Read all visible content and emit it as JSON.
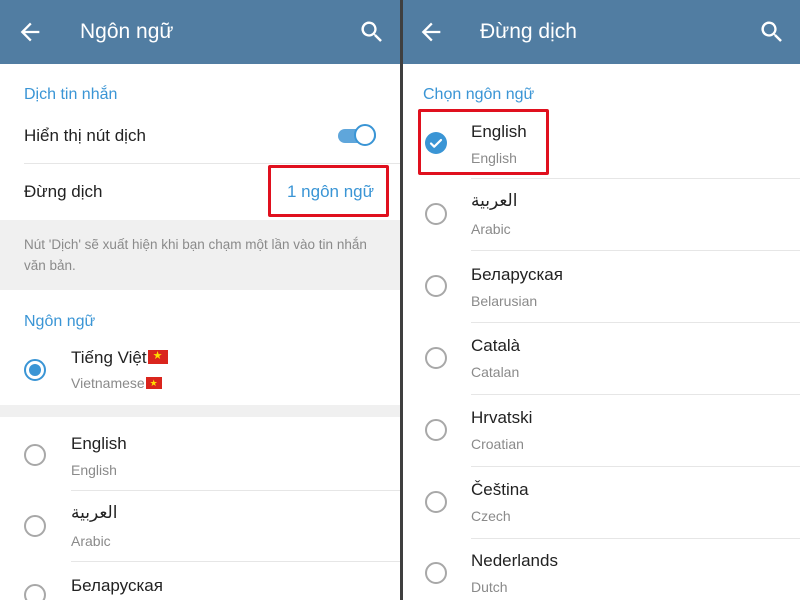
{
  "left": {
    "title": "Ngôn ngữ",
    "section_translate": "Dịch tin nhắn",
    "show_translate_button": {
      "label": "Hiển thị nút dịch",
      "enabled": true
    },
    "do_not_translate": {
      "label": "Đừng dịch",
      "value": "1 ngôn ngữ"
    },
    "hint": "Nút 'Dịch' sẽ xuất hiện khi bạn chạm một lần vào tin nhắn văn bản.",
    "section_language": "Ngôn ngữ",
    "current_language": {
      "name": "Tiếng Việt",
      "native": "Vietnamese",
      "selected": true
    },
    "languages": [
      {
        "name": "English",
        "native": "English"
      },
      {
        "name": "العربية",
        "native": "Arabic"
      },
      {
        "name": "Беларуская",
        "native": ""
      }
    ]
  },
  "right": {
    "title": "Đừng dịch",
    "section": "Chọn ngôn ngữ",
    "languages": [
      {
        "name": "English",
        "native": "English",
        "checked": true
      },
      {
        "name": "العربية",
        "native": "Arabic",
        "checked": false
      },
      {
        "name": "Беларуская",
        "native": "Belarusian",
        "checked": false
      },
      {
        "name": "Català",
        "native": "Catalan",
        "checked": false
      },
      {
        "name": "Hrvatski",
        "native": "Croatian",
        "checked": false
      },
      {
        "name": "Čeština",
        "native": "Czech",
        "checked": false
      },
      {
        "name": "Nederlands",
        "native": "Dutch",
        "checked": false
      }
    ]
  },
  "colors": {
    "header": "#517da2",
    "accent": "#3a95d5",
    "highlight": "#e0101e"
  }
}
